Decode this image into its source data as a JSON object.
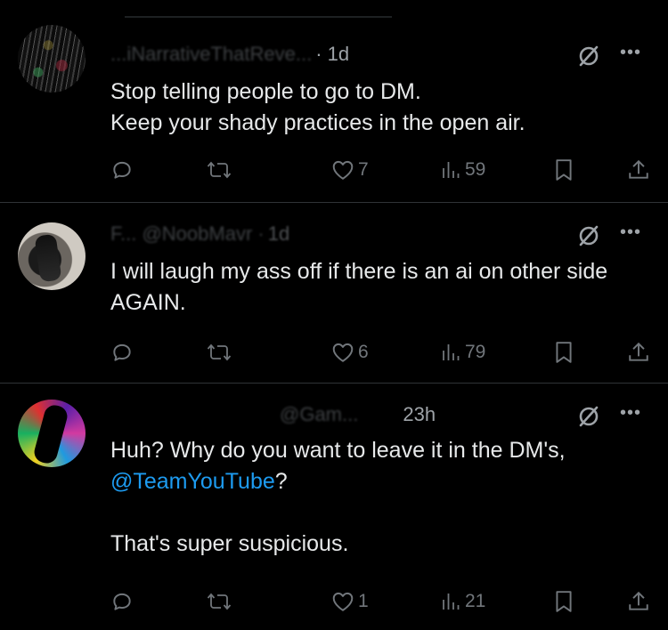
{
  "tweets": [
    {
      "handle": "...iNarrativeThatReve...",
      "time": "· 1d",
      "text": "Stop telling people to go to DM.\nKeep your shady practices in the open air.",
      "mention": "",
      "text_after": "",
      "likes": "7",
      "views": "59"
    },
    {
      "handle": "F... @NoobMavr ·",
      "time": "1d",
      "text": "I will laugh my ass off if there is an ai on other side AGAIN.",
      "mention": "",
      "text_after": "",
      "likes": "6",
      "views": "79"
    },
    {
      "handle": "@Gam...",
      "time": "23h",
      "text": "Huh? Why do you want to leave it in the DM's, ",
      "mention": "@TeamYouTube",
      "text_after": "?\n\nThat's super suspicious.",
      "likes": "1",
      "views": "21"
    }
  ],
  "icons": {
    "more": "•••"
  },
  "colors": {
    "background": "#000000",
    "text": "#e7e9ea",
    "muted": "#71767b",
    "link": "#1d9bf0"
  }
}
